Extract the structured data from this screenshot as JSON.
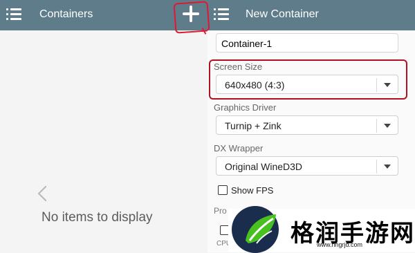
{
  "left_header": {
    "title": "Containers"
  },
  "right_header": {
    "title": "New Container"
  },
  "empty_state": {
    "message": "No items to display"
  },
  "form": {
    "name_value": "Container-1",
    "screen_size": {
      "label": "Screen Size",
      "value": "640x480 (4:3)"
    },
    "graphics_driver": {
      "label": "Graphics Driver",
      "value": "Turnip + Zink"
    },
    "dx_wrapper": {
      "label": "DX Wrapper",
      "value": "Original WineD3D"
    },
    "show_fps": {
      "label": "Show FPS",
      "checked": false
    },
    "partial_label": "Pro",
    "partial_cpu": "CPU"
  },
  "watermark": {
    "text": "格润手游网",
    "url": "www.hngrjd.com"
  },
  "colors": {
    "header": "#5f7c8a",
    "annotation": "#e01830",
    "background": "#f4f4f4"
  },
  "icons": [
    "menu-icon",
    "plus-icon",
    "chevron-left-icon",
    "dropdown-arrow-icon",
    "checkbox-icon"
  ]
}
